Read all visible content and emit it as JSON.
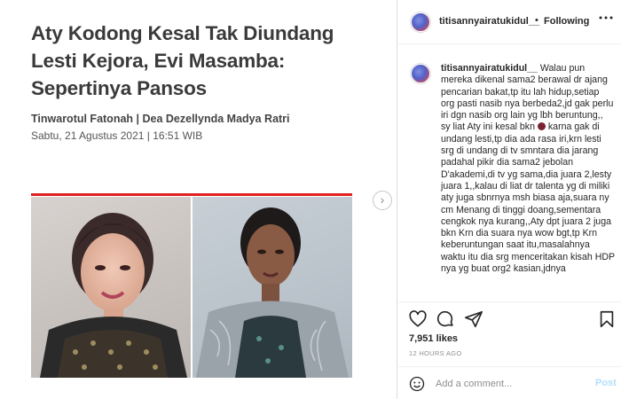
{
  "article": {
    "headline": "Aty Kodong Kesal Tak Diundang Lesti Kejora, Evi Masamba: Sepertinya Pansos",
    "authors": "Tinwarotul Fatonah | Dea Dezellynda Madya Ratri",
    "date": "Sabtu, 21 Agustus 2021 | 16:51 WIB",
    "accent_color": "#e02020"
  },
  "carousel": {
    "next_icon": "chevron-right-icon"
  },
  "header": {
    "username": "titisannyairatukidul__",
    "separator": "•",
    "follow_label": "Following",
    "more_icon": "more-horizontal-icon"
  },
  "caption": {
    "username": "titisannyairatukidul__",
    "text_before_emoji": " Walau pun mereka dikenal sama2 berawal dr ajang pencarian bakat,tp itu lah hidup,setiap org pasti nasib nya berbeda2,jd gak perlu iri dgn nasib org lain yg lbh beruntung,, sy liat Aty ini kesal bkn",
    "text_after_emoji": " karna gak di undang lesti,tp dia ada rasa iri,krn lesti srg di undang di tv smntara dia jarang padahal pikir dia sama2 jebolan D'akademi,di tv yg sama,dia juara 2,lesty juara 1,,kalau di liat dr talenta yg di miliki aty juga sbnrnya msh biasa aja,suara ny cm Menang di tinggi doang,sementara cengkok nya kurang,,Aty dpt juara 2 juga bkn Krn dia suara nya wow bgt,tp Krn keberuntungan saat itu,masalahnya waktu itu dia srg menceritakan kisah HDP nya yg buat org2 kasian,jdnya"
  },
  "actions": {
    "likes": "7,951 likes",
    "time": "12 HOURS AGO"
  },
  "add_comment": {
    "placeholder": "Add a comment...",
    "post_label": "Post"
  },
  "colors": {
    "link_blue_disabled": "#b2dffc",
    "border": "#dbdbdb",
    "muted": "#8e8e8e"
  }
}
